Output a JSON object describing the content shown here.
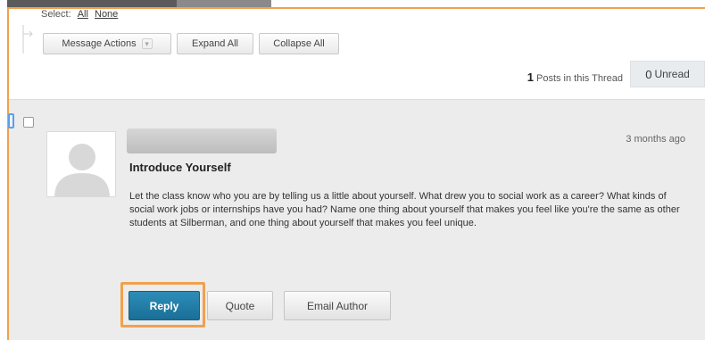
{
  "selection": {
    "label": "Select:",
    "all": "All",
    "none": "None"
  },
  "toolbar": {
    "message_actions": "Message Actions",
    "expand_all": "Expand All",
    "collapse_all": "Collapse All"
  },
  "thread_info": {
    "posts_count": "1",
    "posts_label": "Posts in this Thread",
    "unread_count": "0",
    "unread_label": "Unread"
  },
  "post": {
    "timestamp": "3 months ago",
    "title": "Introduce Yourself",
    "body": "Let the class know who you are by telling us a little about yourself. What drew you to social work as a career?  What kinds of social work jobs or internships have you had? Name one thing about yourself that makes you feel like you're the same as other students at Silberman, and one thing about yourself that makes you feel unique."
  },
  "actions": {
    "reply": "Reply",
    "quote": "Quote",
    "email_author": "Email Author"
  },
  "colors": {
    "accent_highlight": "#f0a14e",
    "reply_button": "#1f7aa6",
    "panel_bg": "#ececec",
    "marker_blue": "#5aa0e8"
  },
  "icons": {
    "message_actions_chevron": "chevron-down-icon",
    "avatar": "user-placeholder-icon"
  }
}
